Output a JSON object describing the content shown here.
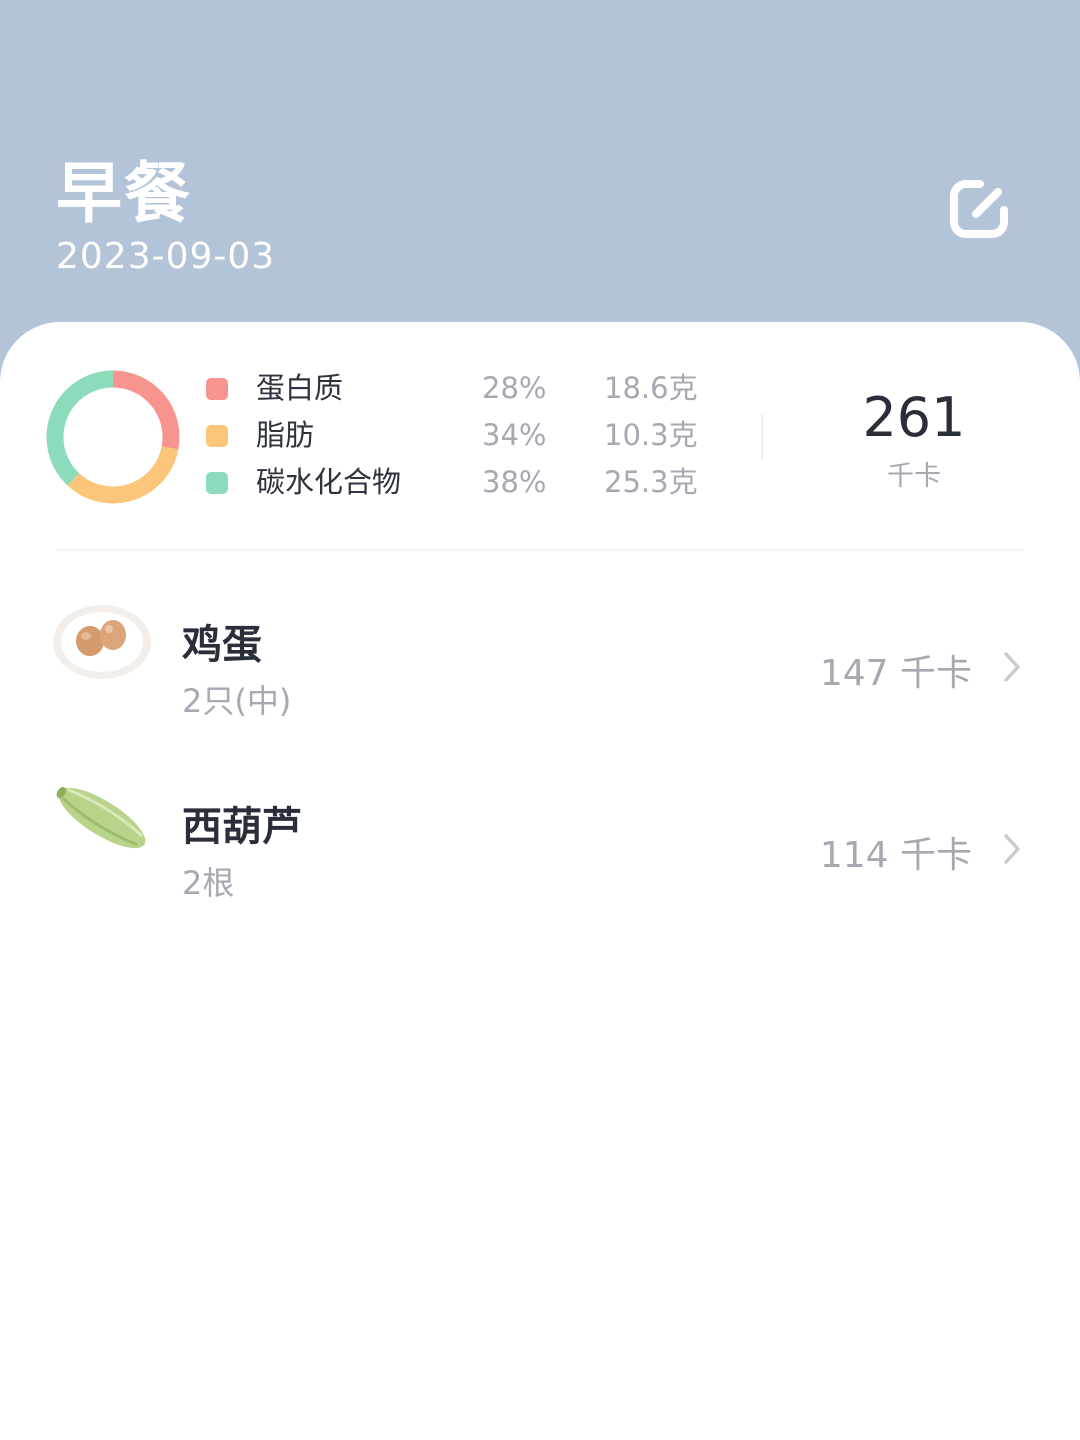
{
  "header": {
    "title": "早餐",
    "date": "2023-09-03",
    "edit_icon": "edit-icon"
  },
  "summary": {
    "macros": [
      {
        "name": "蛋白质",
        "percent": "28%",
        "grams": "18.6克",
        "color": "#f89490"
      },
      {
        "name": "脂肪",
        "percent": "34%",
        "grams": "10.3克",
        "color": "#fbc679"
      },
      {
        "name": "碳水化合物",
        "percent": "38%",
        "grams": "25.3克",
        "color": "#8cdcbc"
      }
    ],
    "total_kcal": "261",
    "kcal_unit": "千卡"
  },
  "foods": [
    {
      "name": "鸡蛋",
      "quantity": "2只(中)",
      "kcal": "147 千卡",
      "image": "egg-plate-image"
    },
    {
      "name": "西葫芦",
      "quantity": "2根",
      "kcal": "114 千卡",
      "image": "zucchini-image"
    }
  ],
  "colors": {
    "header_bg": "#b3c3d8",
    "protein": "#f89490",
    "fat": "#fbc679",
    "carb": "#8cdcbc"
  },
  "chart_data": {
    "type": "pie",
    "categories": [
      "蛋白质",
      "脂肪",
      "碳水化合物"
    ],
    "values": [
      28,
      34,
      38
    ]
  }
}
